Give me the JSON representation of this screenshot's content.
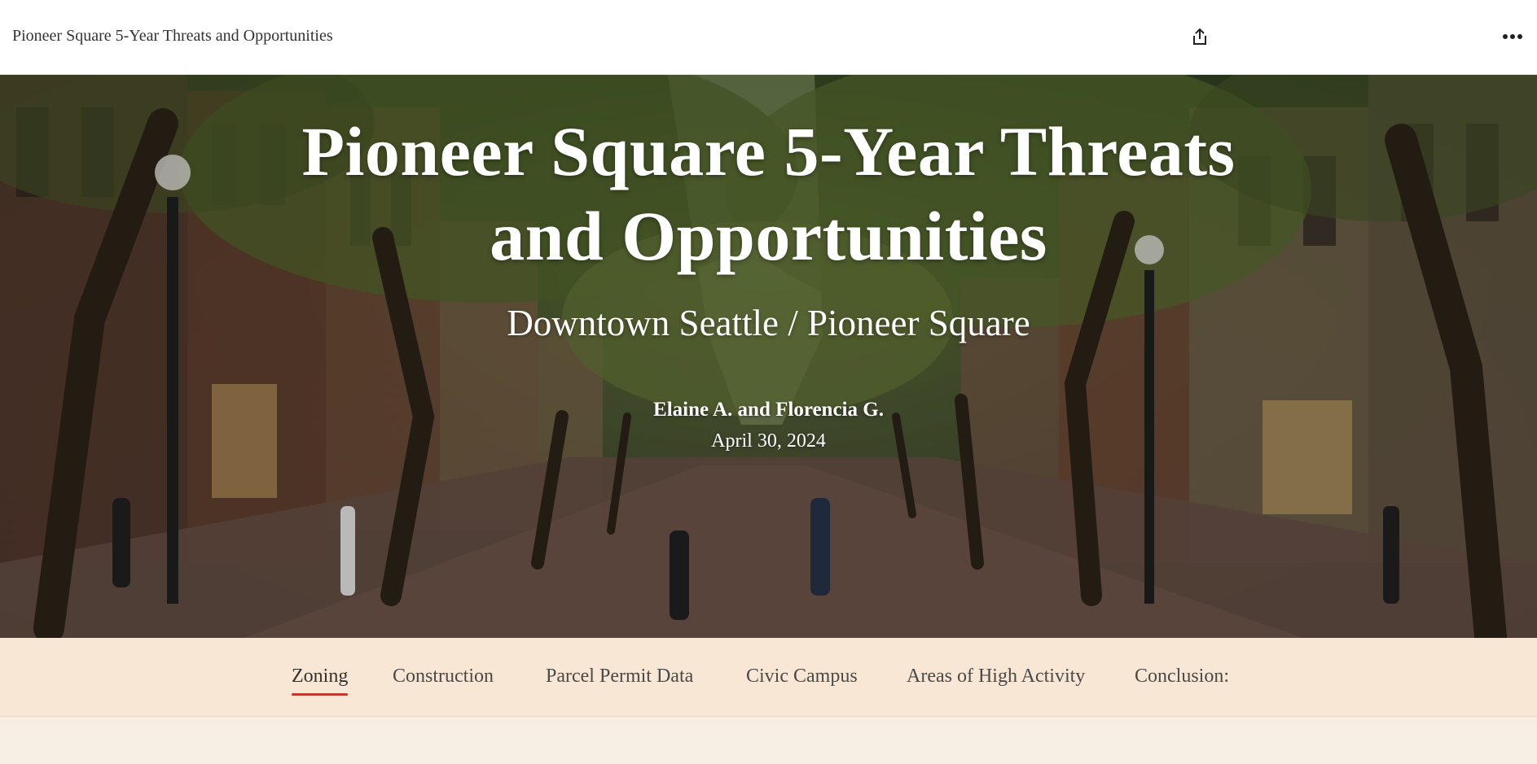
{
  "header": {
    "title": "Pioneer Square 5-Year Threats and Opportunities",
    "actions": [
      {
        "name": "share",
        "icon": "share-icon"
      },
      {
        "name": "more",
        "icon": "more-options-icon"
      }
    ]
  },
  "hero": {
    "title_line1": "Pioneer Square 5-Year Threats",
    "title_line2": "and Opportunities",
    "subtitle": "Downtown Seattle / Pioneer Square",
    "authors": "Elaine A. and Florencia G.",
    "date": "April 30, 2024"
  },
  "nav": {
    "items": [
      {
        "label": "Zoning",
        "active": true
      },
      {
        "label": "Construction",
        "active": false
      },
      {
        "label": "Parcel Permit Data",
        "active": false
      },
      {
        "label": "Civic Campus",
        "active": false
      },
      {
        "label": "Areas of High Activity",
        "active": false
      },
      {
        "label": "Conclusion:",
        "active": false
      }
    ]
  },
  "colors": {
    "nav_background": "#f7e7d4",
    "page_background": "#f8efe4",
    "active_underline": "#c0392b"
  }
}
